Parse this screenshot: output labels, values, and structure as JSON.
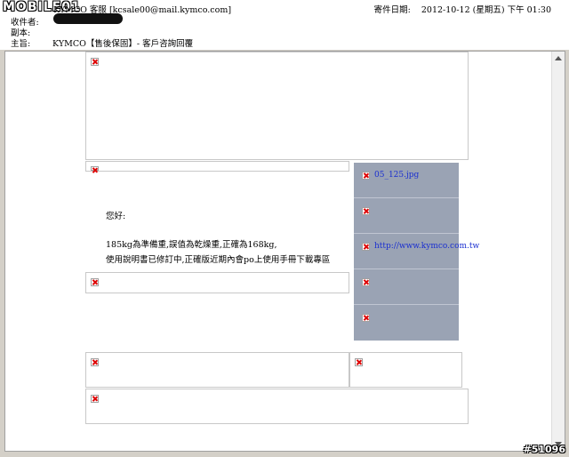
{
  "header": {
    "from_label": "寄件者:",
    "from_value": "KYMCO 客服 [kcsale00@mail.kymco.com]",
    "date_label": "寄件日期:",
    "date_value": "2012-10-12 (星期五) 下午 01:30",
    "to_label": "收件者:",
    "cc_label": "副本:",
    "subject_label": "主旨:",
    "subject_value": "KYMCO【售後保固】- 客戶咨詢回覆"
  },
  "watermark": {
    "logo": "MOBILE01",
    "id": "#51096"
  },
  "body": {
    "greeting": "您好:",
    "line1": "185kg為準備重,誤值為乾燥重,正確為168kg,",
    "line2": "使用說明書已修訂中,正確版近期內會po上使用手冊下載專區"
  },
  "sidebar": {
    "items": [
      {
        "label": "05_125.jpg"
      },
      {
        "label": ""
      },
      {
        "label": "http://www.kymco.com.tw"
      },
      {
        "label": ""
      },
      {
        "label": ""
      }
    ]
  }
}
